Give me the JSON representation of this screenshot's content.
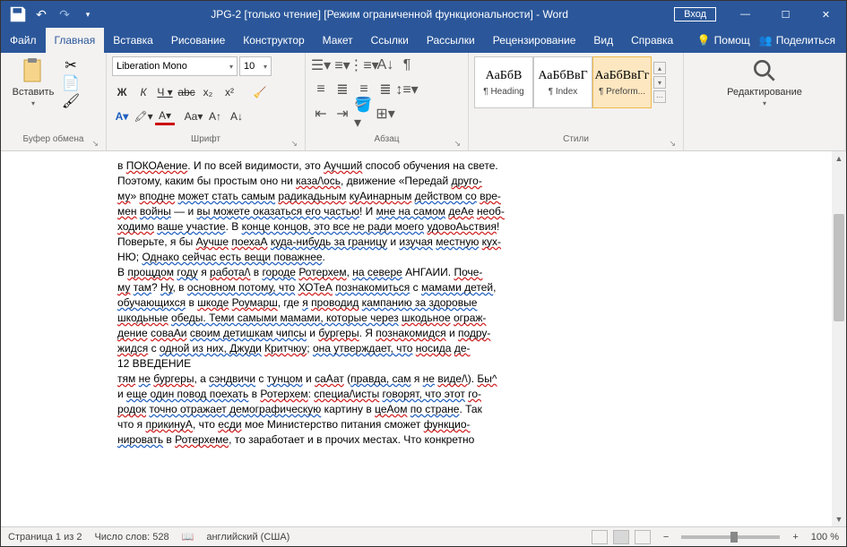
{
  "titlebar": {
    "title": "JPG-2 [только чтение] [Режим ограниченной функциональности]  -  Word",
    "login": "Вход"
  },
  "tabs": {
    "file": "Файл",
    "home": "Главная",
    "insert": "Вставка",
    "draw": "Рисование",
    "design": "Конструктор",
    "layout": "Макет",
    "references": "Ссылки",
    "mailings": "Рассылки",
    "review": "Рецензирование",
    "view": "Вид",
    "help": "Справка",
    "tell": "Помощ",
    "share": "Поделиться"
  },
  "ribbon": {
    "clipboard": {
      "label": "Буфер обмена",
      "paste": "Вставить"
    },
    "font": {
      "label": "Шрифт",
      "name": "Liberation Mono",
      "size": "10"
    },
    "paragraph": {
      "label": "Абзац"
    },
    "styles": {
      "label": "Стили",
      "items": [
        {
          "preview": "АаБбВ",
          "name": "¶ Heading"
        },
        {
          "preview": "АаБбВвГ",
          "name": "¶ Index"
        },
        {
          "preview": "АаБбВвГг",
          "name": "¶ Preform..."
        }
      ]
    },
    "editing": {
      "label": "Редактирование"
    }
  },
  "document": {
    "lines": [
      [
        {
          "t": "в "
        },
        {
          "t": "ПОКОАение",
          "c": "redu"
        },
        {
          "t": ". И по всей видимости, это "
        },
        {
          "t": "Аучший",
          "c": "redu"
        },
        {
          "t": " способ обучения на свете."
        }
      ],
      [
        {
          "t": "Поэтому, каким бы простым оно ни "
        },
        {
          "t": "каза/\\ось",
          "c": "redu"
        },
        {
          "t": ", движение «Передай "
        },
        {
          "t": "друго-",
          "c": "redu"
        }
      ],
      [
        {
          "t": "му",
          "c": "redu"
        },
        {
          "t": "» "
        },
        {
          "t": "вподне",
          "c": "redu"
        },
        {
          "t": " "
        },
        {
          "t": "может стать самым",
          "c": "blu"
        },
        {
          "t": " "
        },
        {
          "t": "радикадьным",
          "c": "redu"
        },
        {
          "t": " "
        },
        {
          "t": "куАинарным",
          "c": "redu"
        },
        {
          "t": " "
        },
        {
          "t": "действом со",
          "c": "blu"
        },
        {
          "t": " "
        },
        {
          "t": "вре-",
          "c": "redu"
        }
      ],
      [
        {
          "t": "мен",
          "c": "redu"
        },
        {
          "t": " "
        },
        {
          "t": "войны",
          "c": "blu"
        },
        {
          "t": " — и "
        },
        {
          "t": "вы можете оказаться его частью",
          "c": "blu"
        },
        {
          "t": "! И "
        },
        {
          "t": "мне на самом",
          "c": "blu"
        },
        {
          "t": " "
        },
        {
          "t": "деАе",
          "c": "redu"
        },
        {
          "t": " "
        },
        {
          "t": "необ-",
          "c": "redu"
        }
      ],
      [
        {
          "t": "ходимо",
          "c": "redu"
        },
        {
          "t": " "
        },
        {
          "t": "ваше участие",
          "c": "blu"
        },
        {
          "t": ". В "
        },
        {
          "t": "конце концов, это все не ради моего",
          "c": "blu"
        },
        {
          "t": " "
        },
        {
          "t": "удовоАьствия",
          "c": "redu"
        },
        {
          "t": "!"
        }
      ],
      [
        {
          "t": "Поверьте, я бы "
        },
        {
          "t": "Аучше",
          "c": "redu"
        },
        {
          "t": " "
        },
        {
          "t": "поехаА",
          "c": "redu"
        },
        {
          "t": " "
        },
        {
          "t": "куда-нибудь за границу",
          "c": "blu"
        },
        {
          "t": " и "
        },
        {
          "t": "изучая",
          "c": "blu"
        },
        {
          "t": " "
        },
        {
          "t": "местную",
          "c": "blu"
        },
        {
          "t": " "
        },
        {
          "t": "кух-",
          "c": "redu"
        }
      ],
      [
        {
          "t": " "
        }
      ],
      [
        {
          "t": "НЮ; "
        },
        {
          "t": "Однако сейчас есть вещи поважнее",
          "c": "blu"
        },
        {
          "t": "."
        }
      ],
      [
        {
          "t": " "
        }
      ],
      [
        {
          "t": "В "
        },
        {
          "t": "прощдом",
          "c": "redu"
        },
        {
          "t": " "
        },
        {
          "t": "году",
          "c": "blu"
        },
        {
          "t": " я "
        },
        {
          "t": "работа/\\",
          "c": "redu"
        },
        {
          "t": " в "
        },
        {
          "t": "городе",
          "c": "blu"
        },
        {
          "t": " "
        },
        {
          "t": "Ротерхем",
          "c": "redu"
        },
        {
          "t": ", "
        },
        {
          "t": "на севере",
          "c": "blu"
        },
        {
          "t": " АНГАИИ. "
        },
        {
          "t": "Поче-",
          "c": "redu"
        }
      ],
      [
        {
          "t": "му",
          "c": "redu"
        },
        {
          "t": " "
        },
        {
          "t": "там",
          "c": "blu"
        },
        {
          "t": "? "
        },
        {
          "t": "Ну",
          "c": "blu"
        },
        {
          "t": ", в "
        },
        {
          "t": "основном потому, что",
          "c": "blu"
        },
        {
          "t": " "
        },
        {
          "t": "ХОТеА",
          "c": "redu"
        },
        {
          "t": " "
        },
        {
          "t": "познакомиться",
          "c": "blu"
        },
        {
          "t": " с "
        },
        {
          "t": "мамами детей",
          "c": "blu"
        },
        {
          "t": ","
        }
      ],
      [
        {
          "t": "обучающихся",
          "c": "blu"
        },
        {
          "t": " в "
        },
        {
          "t": "шкоде",
          "c": "redu"
        },
        {
          "t": " "
        },
        {
          "t": "Роумарш",
          "c": "redu"
        },
        {
          "t": ", где "
        },
        {
          "t": "я",
          "c": "blu"
        },
        {
          "t": " "
        },
        {
          "t": "проводид",
          "c": "redu"
        },
        {
          "t": " "
        },
        {
          "t": "кампанию за здоровые",
          "c": "blu"
        }
      ],
      [
        {
          "t": "шкодьные",
          "c": "redu"
        },
        {
          "t": " "
        },
        {
          "t": "обеды. Теми самыми мамами, которые через",
          "c": "blu"
        },
        {
          "t": " "
        },
        {
          "t": "шкодьное",
          "c": "redu"
        },
        {
          "t": " "
        },
        {
          "t": "ограж-",
          "c": "redu"
        }
      ],
      [
        {
          "t": "дение",
          "c": "redu"
        },
        {
          "t": " "
        },
        {
          "t": "соваАи",
          "c": "redu"
        },
        {
          "t": " "
        },
        {
          "t": "своим детишкам чипсы",
          "c": "blu"
        },
        {
          "t": " и "
        },
        {
          "t": "бургеры",
          "c": "redu"
        },
        {
          "t": ". Я "
        },
        {
          "t": "познакомидся",
          "c": "redu"
        },
        {
          "t": " и "
        },
        {
          "t": "подру-",
          "c": "redu"
        }
      ],
      [
        {
          "t": " "
        }
      ],
      [
        {
          "t": "жидся",
          "c": "redu"
        },
        {
          "t": " с "
        },
        {
          "t": "одной из них, Джуди",
          "c": "blu"
        },
        {
          "t": " "
        },
        {
          "t": "Критчюу",
          "c": "redu"
        },
        {
          "t": "; "
        },
        {
          "t": "она утверждает, что",
          "c": "blu"
        },
        {
          "t": " "
        },
        {
          "t": "носида",
          "c": "redu"
        },
        {
          "t": " "
        },
        {
          "t": "де-",
          "c": "redu"
        }
      ],
      [
        {
          "t": " "
        }
      ],
      [
        {
          "t": "12 ВВЕДЕНИЕ"
        }
      ],
      [
        {
          "t": " "
        }
      ],
      [
        {
          "t": " "
        }
      ],
      [
        {
          "t": "тям",
          "c": "redu"
        },
        {
          "t": " "
        },
        {
          "t": "не",
          "c": "blu"
        },
        {
          "t": " "
        },
        {
          "t": "бургеры",
          "c": "redu"
        },
        {
          "t": ", а "
        },
        {
          "t": "сэндвичи",
          "c": "blu"
        },
        {
          "t": " с "
        },
        {
          "t": "тунцом",
          "c": "blu"
        },
        {
          "t": " и "
        },
        {
          "t": "саАат",
          "c": "redu"
        },
        {
          "t": " ("
        },
        {
          "t": "правда, сам",
          "c": "blu"
        },
        {
          "t": " я "
        },
        {
          "t": "не",
          "c": "blu"
        },
        {
          "t": " "
        },
        {
          "t": "виде/\\",
          "c": "redu"
        },
        {
          "t": "). "
        },
        {
          "t": "Бы^",
          "c": "redu"
        }
      ],
      [
        {
          "t": "и "
        },
        {
          "t": "еще один повод поехать",
          "c": "blu"
        },
        {
          "t": " в "
        },
        {
          "t": "Ротерхем",
          "c": "redu"
        },
        {
          "t": ": "
        },
        {
          "t": "специа/\\исты",
          "c": "redu"
        },
        {
          "t": " "
        },
        {
          "t": "говорят, что этот",
          "c": "blu"
        },
        {
          "t": " "
        },
        {
          "t": "го-",
          "c": "redu"
        }
      ],
      [
        {
          "t": "родок",
          "c": "redu"
        },
        {
          "t": " "
        },
        {
          "t": "точно отражает демографическую",
          "c": "blu"
        },
        {
          "t": " картину в "
        },
        {
          "t": "цеАом",
          "c": "redu"
        },
        {
          "t": " "
        },
        {
          "t": "по стране",
          "c": "blu"
        },
        {
          "t": ". Так"
        }
      ],
      [
        {
          "t": "что я "
        },
        {
          "t": "прикинуА",
          "c": "redu"
        },
        {
          "t": ", что "
        },
        {
          "t": "есди",
          "c": "redu"
        },
        {
          "t": " мое Министерство питания сможет "
        },
        {
          "t": "функцио-",
          "c": "redu"
        }
      ],
      [
        {
          "t": "нировать",
          "c": "blu"
        },
        {
          "t": " в "
        },
        {
          "t": "Ротерхеме",
          "c": "redu"
        },
        {
          "t": ", то заработает и в прочих местах. Что конкретно"
        }
      ]
    ]
  },
  "status": {
    "page": "Страница 1 из 2",
    "words": "Число слов: 528",
    "lang": "английский (США)",
    "zoom": "100 %"
  }
}
